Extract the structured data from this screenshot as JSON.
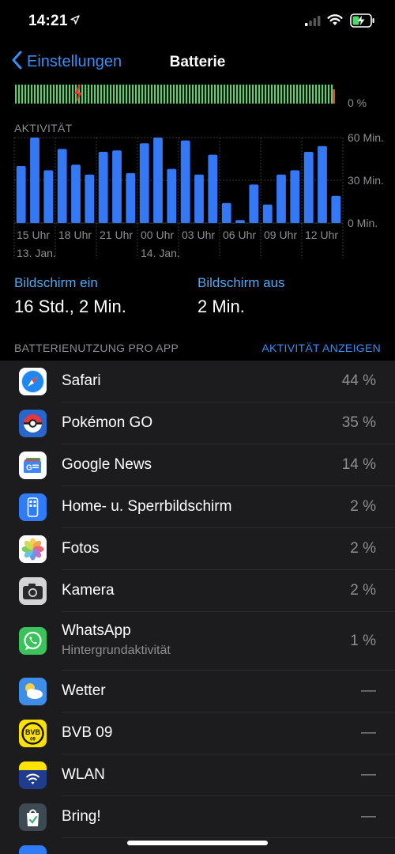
{
  "status_bar": {
    "time": "14:21"
  },
  "nav": {
    "back_label": "Einstellungen",
    "title": "Batterie"
  },
  "battery_level": {
    "pct_label": "0 %"
  },
  "activity": {
    "label": "AKTIVITÄT",
    "y_labels": [
      "60 Min.",
      "30 Min.",
      "0 Min."
    ],
    "x_labels": [
      "15 Uhr",
      "18 Uhr",
      "21 Uhr",
      "00 Uhr",
      "03 Uhr",
      "06 Uhr",
      "09 Uhr",
      "12 Uhr"
    ],
    "date_labels": [
      "13. Jan.",
      "14. Jan."
    ]
  },
  "chart_data": {
    "type": "bar",
    "title": "AKTIVITÄT",
    "ylabel": "",
    "ylim": [
      0,
      60
    ],
    "y_ticks": [
      "0 Min.",
      "30 Min.",
      "60 Min."
    ],
    "x_tick_labels": [
      "15 Uhr",
      "18 Uhr",
      "21 Uhr",
      "00 Uhr",
      "03 Uhr",
      "06 Uhr",
      "09 Uhr",
      "12 Uhr"
    ],
    "values": [
      40,
      60,
      37,
      52,
      41,
      34,
      50,
      51,
      35,
      56,
      60,
      38,
      58,
      34,
      48,
      14,
      2,
      27,
      13,
      34,
      37,
      50,
      54,
      19
    ],
    "grid": true
  },
  "screen": {
    "on_title": "Bildschirm ein",
    "on_value": "16 Std., 2 Min.",
    "off_title": "Bildschirm aus",
    "off_value": "2 Min."
  },
  "usage": {
    "header": "BATTERIENUTZUNG PRO APP",
    "link": "AKTIVITÄT ANZEIGEN",
    "apps": [
      {
        "name": "Safari",
        "pct": "44 %",
        "icon": "safari-icon"
      },
      {
        "name": "Pokémon GO",
        "pct": "35 %",
        "icon": "pokemon-go-icon"
      },
      {
        "name": "Google News",
        "pct": "14 %",
        "icon": "google-news-icon"
      },
      {
        "name": "Home- u. Sperrbildschirm",
        "pct": "2 %",
        "icon": "home-lock-screen-icon"
      },
      {
        "name": "Fotos",
        "pct": "2 %",
        "icon": "photos-icon"
      },
      {
        "name": "Kamera",
        "pct": "2 %",
        "icon": "camera-icon"
      },
      {
        "name": "WhatsApp",
        "sub": "Hintergrundaktivität",
        "pct": "1 %",
        "icon": "whatsapp-icon"
      },
      {
        "name": "Wetter",
        "pct": "—",
        "icon": "weather-icon"
      },
      {
        "name": "BVB 09",
        "pct": "—",
        "icon": "bvb-icon"
      },
      {
        "name": "WLAN",
        "pct": "—",
        "icon": "wlan-icon"
      },
      {
        "name": "Bring!",
        "pct": "—",
        "icon": "bring-icon"
      }
    ]
  },
  "colors": {
    "accent": "#3b8cf5",
    "bar": "#3478f6",
    "level": "#4cd964"
  }
}
